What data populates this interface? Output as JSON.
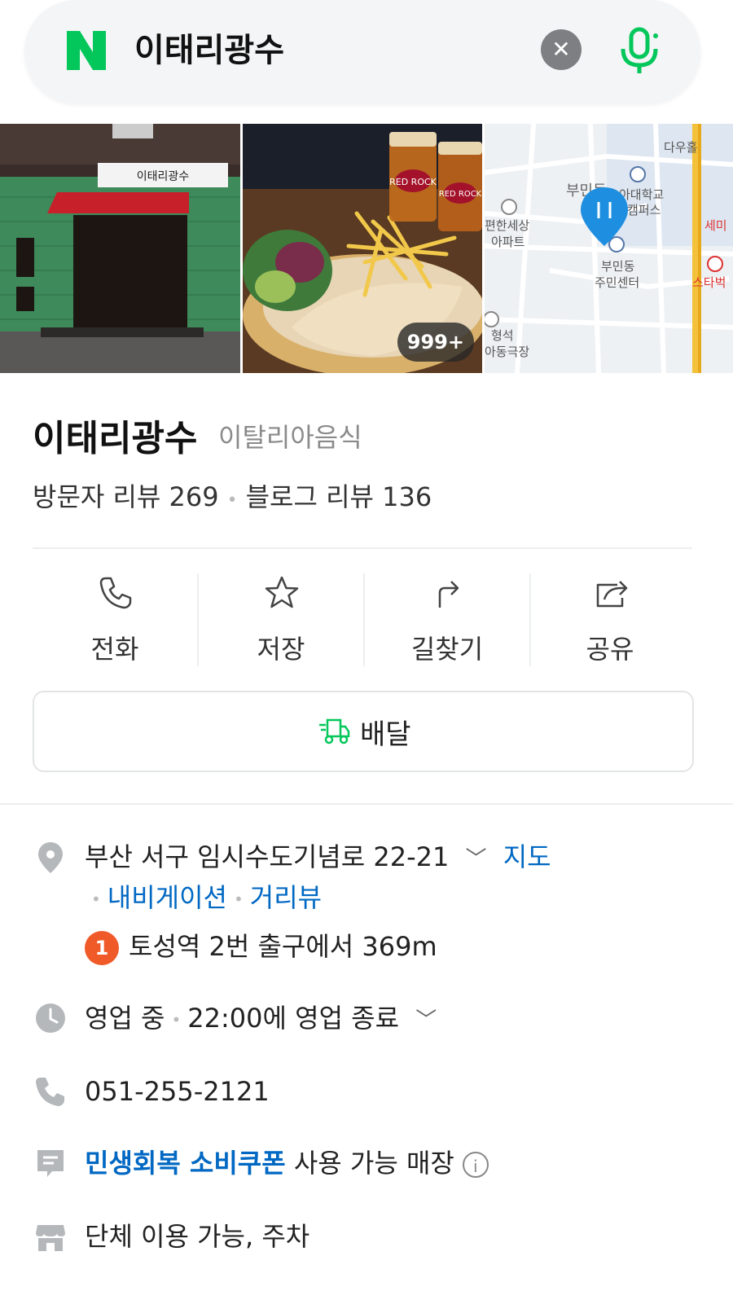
{
  "search": {
    "query": "이태리광수",
    "logo_letter": "N",
    "brand_color": "#03c75a"
  },
  "photos": {
    "count_badge": "999+",
    "storefront_sign": "이태리광수",
    "map": {
      "labels": [
        "다우홀",
        "부민동",
        "아대학교",
        "캠퍼스",
        "세미",
        "편한세상",
        "아파트",
        "부민동",
        "주민센터",
        "스타벅",
        "형석",
        "아동극장"
      ]
    }
  },
  "place": {
    "name": "이태리광수",
    "category": "이탈리아음식",
    "visitor_review_label": "방문자 리뷰 269",
    "blog_review_label": "블로그 리뷰 136"
  },
  "actions": [
    {
      "label": "전화",
      "icon": "phone-icon"
    },
    {
      "label": "저장",
      "icon": "star-icon"
    },
    {
      "label": "길찾기",
      "icon": "directions-icon"
    },
    {
      "label": "공유",
      "icon": "share-icon"
    }
  ],
  "delivery": {
    "label": "배달",
    "icon": "delivery-truck-icon"
  },
  "info": {
    "address": "부산 서구 임시수도기념로 22-21",
    "map_link": "지도",
    "navigation_link": "내비게이션",
    "streetview_link": "거리뷰",
    "subway_line": "1",
    "subway_text": "토성역 2번 출구에서 369m",
    "hours_status": "영업 중",
    "hours_detail": "22:00에 영업 종료",
    "phone": "051-255-2121",
    "coupon_link": "민생회복 소비쿠폰",
    "coupon_text": " 사용 가능 매장",
    "facilities": "단체 이용 가능, 주차"
  },
  "colors": {
    "accent": "#03c75a",
    "link": "#0068c3",
    "subway_line1": "#f05a28"
  }
}
